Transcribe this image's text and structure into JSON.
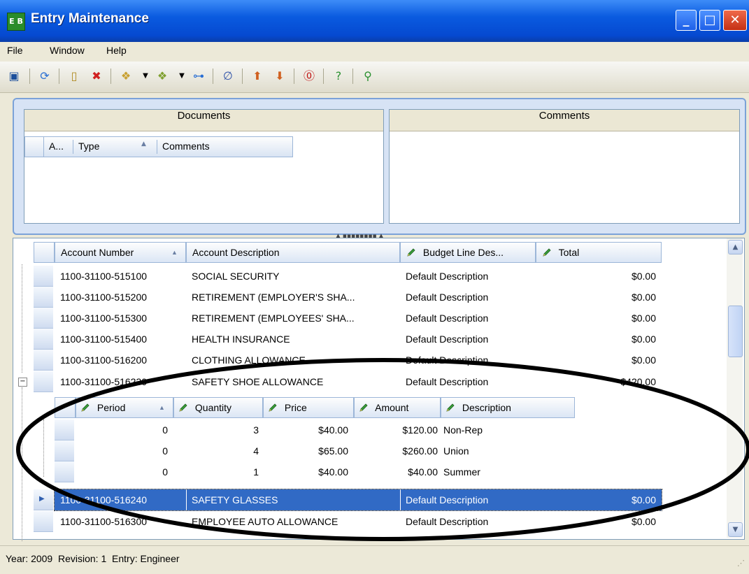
{
  "window": {
    "title": "Entry Maintenance",
    "app_icon_text": "E B",
    "controls": [
      "minimize",
      "maximize",
      "close"
    ]
  },
  "menu": {
    "items": [
      "File",
      "Window",
      "Help"
    ]
  },
  "toolbar": {
    "icons": [
      "save-icon",
      "refresh-icon",
      "new-icon",
      "delete-icon",
      "import-icon",
      "dropdown-icon",
      "export-icon",
      "dropdown-icon",
      "tree-icon",
      "attach-icon",
      "up-icon",
      "down-icon",
      "stop-icon",
      "help-icon",
      "key-icon"
    ]
  },
  "documents_panel": {
    "title": "Documents",
    "columns": [
      "A...",
      "Type",
      "Comments"
    ]
  },
  "comments_panel": {
    "title": "Comments"
  },
  "grid": {
    "columns": {
      "account_number": "Account Number",
      "account_description": "Account Description",
      "budget_line_desc": "Budget Line Des...",
      "total": "Total"
    },
    "rows": [
      {
        "account": "1100-31100-515100",
        "desc": "SOCIAL SECURITY",
        "budget": "Default Description",
        "total": "$0.00"
      },
      {
        "account": "1100-31100-515200",
        "desc": "RETIREMENT (EMPLOYER'S SHA...",
        "budget": "Default Description",
        "total": "$0.00"
      },
      {
        "account": "1100-31100-515300",
        "desc": "RETIREMENT (EMPLOYEES' SHA...",
        "budget": "Default Description",
        "total": "$0.00"
      },
      {
        "account": "1100-31100-515400",
        "desc": "HEALTH INSURANCE",
        "budget": "Default Description",
        "total": "$0.00"
      },
      {
        "account": "1100-31100-516200",
        "desc": "CLOTHING ALLOWANCE",
        "budget": "Default Description",
        "total": "$0.00"
      },
      {
        "account": "1100-31100-516230",
        "desc": "SAFETY SHOE ALLOWANCE",
        "budget": "Default Description",
        "total": "$420.00"
      }
    ],
    "sub_columns": {
      "period": "Period",
      "quantity": "Quantity",
      "price": "Price",
      "amount": "Amount",
      "description": "Description"
    },
    "sub_rows": [
      {
        "period": "0",
        "quantity": "3",
        "price": "$40.00",
        "amount": "$120.00",
        "description": "Non-Rep"
      },
      {
        "period": "0",
        "quantity": "4",
        "price": "$65.00",
        "amount": "$260.00",
        "description": "Union"
      },
      {
        "period": "0",
        "quantity": "1",
        "price": "$40.00",
        "amount": "$40.00",
        "description": "Summer"
      }
    ],
    "rows_after": [
      {
        "account": "1100-31100-516240",
        "desc": "SAFETY GLASSES",
        "budget": "Default Description",
        "total": "$0.00",
        "selected": true
      },
      {
        "account": "1100-31100-516300",
        "desc": "EMPLOYEE AUTO ALLOWANCE",
        "budget": "Default Description",
        "total": "$0.00"
      }
    ]
  },
  "status": {
    "text": "Year: 2009  Revision: 1  Entry: Engineer"
  },
  "colors": {
    "title_blue": "#0a5be0",
    "selection": "#316ac5",
    "annotation": "#000000"
  }
}
